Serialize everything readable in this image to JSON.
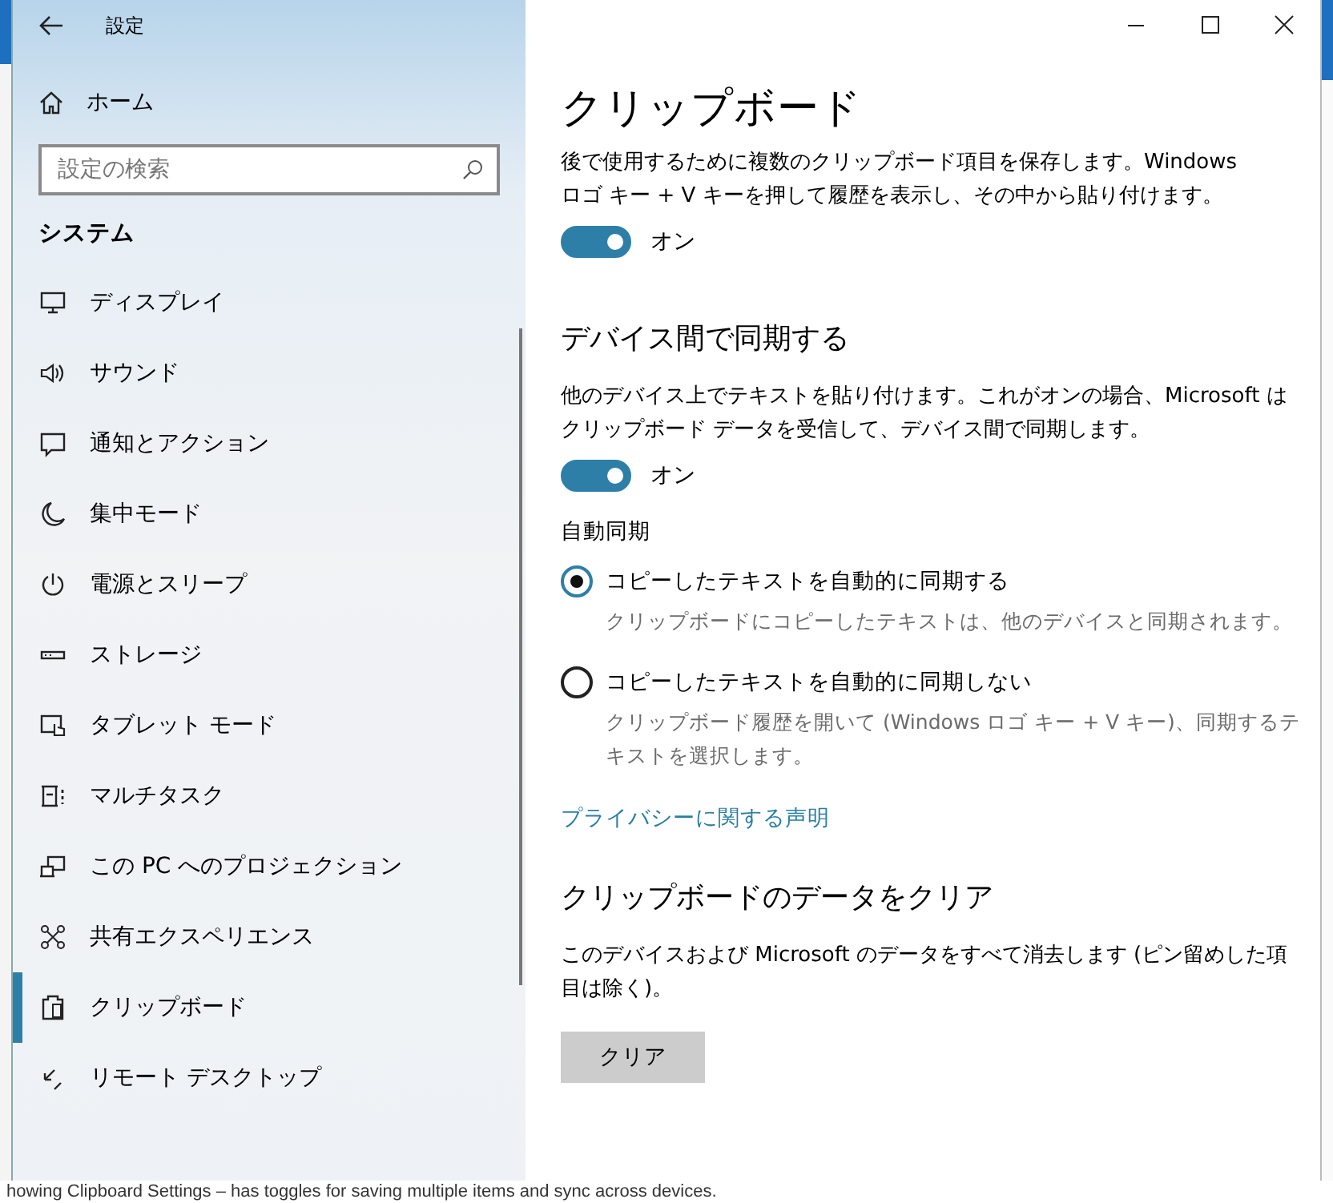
{
  "window": {
    "title": "設定"
  },
  "sidebar": {
    "home": "ホーム",
    "search": {
      "placeholder": "設定の検索"
    },
    "section": "システム",
    "items": [
      {
        "label": "ディスプレイ",
        "selected": false
      },
      {
        "label": "サウンド",
        "selected": false
      },
      {
        "label": "通知とアクション",
        "selected": false
      },
      {
        "label": "集中モード",
        "selected": false
      },
      {
        "label": "電源とスリープ",
        "selected": false
      },
      {
        "label": "ストレージ",
        "selected": false
      },
      {
        "label": "タブレット モード",
        "selected": false
      },
      {
        "label": "マルチタスク",
        "selected": false
      },
      {
        "label": "この PC へのプロジェクション",
        "selected": false
      },
      {
        "label": "共有エクスペリエンス",
        "selected": false
      },
      {
        "label": "クリップボード",
        "selected": true
      },
      {
        "label": "リモート デスクトップ",
        "selected": false
      }
    ]
  },
  "page": {
    "title": "クリップボード",
    "history": {
      "description": "後で使用するために複数のクリップボード項目を保存します。Windows ロゴ キー + V キーを押して履歴を表示し、その中から貼り付けます。",
      "toggle": {
        "on": true,
        "label": "オン"
      }
    },
    "sync": {
      "heading": "デバイス間で同期する",
      "description": "他のデバイス上でテキストを貼り付けます。これがオンの場合、Microsoft はクリップボード データを受信して、デバイス間で同期します。",
      "toggle": {
        "on": true,
        "label": "オン"
      },
      "subheading": "自動同期",
      "options": [
        {
          "label": "コピーしたテキストを自動的に同期する",
          "description": "クリップボードにコピーしたテキストは、他のデバイスと同期されます。",
          "selected": true
        },
        {
          "label": "コピーしたテキストを自動的に同期しない",
          "description": "クリップボード履歴を開いて (Windows ロゴ キー + V キー)、同期するテキストを選択します。",
          "selected": false
        }
      ]
    },
    "privacy_link": "プライバシーに関する声明",
    "clear": {
      "heading": "クリップボードのデータをクリア",
      "description": "このデバイスおよび Microsoft のデータをすべて消去します (ピン留めした項目は除く)。",
      "button": "クリア"
    }
  },
  "caption": "howing Clipboard Settings – has toggles for saving multiple items and sync across devices."
}
